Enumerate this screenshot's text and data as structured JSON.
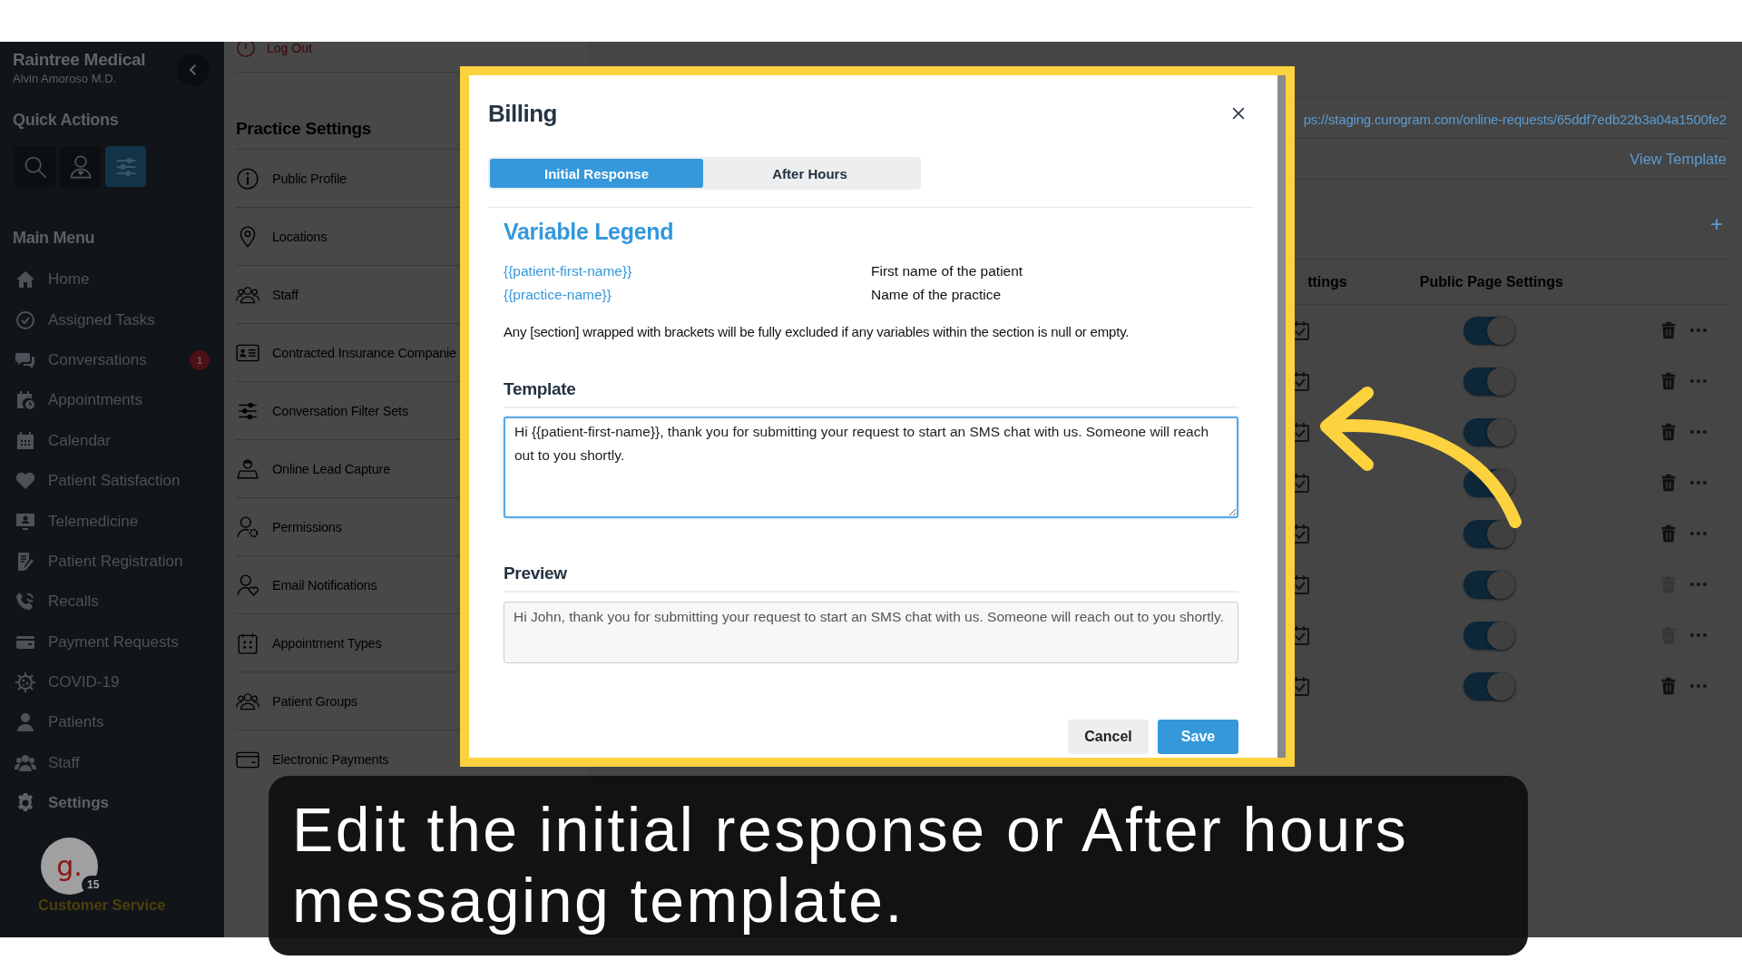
{
  "sidebar": {
    "brand": "Raintree Medical",
    "user": "Alvin Amoroso M.D.",
    "quick_actions_title": "Quick Actions",
    "quick_actions": [
      {
        "selected": false
      },
      {
        "selected": false
      },
      {
        "selected": true
      }
    ],
    "main_menu_title": "Main Menu",
    "menu": [
      {
        "label": "Home",
        "selected": false
      },
      {
        "label": "Assigned Tasks",
        "selected": false
      },
      {
        "label": "Conversations",
        "selected": false,
        "badge": "1"
      },
      {
        "label": "Appointments",
        "selected": false
      },
      {
        "label": "Calendar",
        "selected": false
      },
      {
        "label": "Patient Satisfaction",
        "selected": false
      },
      {
        "label": "Telemedicine",
        "selected": false
      },
      {
        "label": "Patient Registration",
        "selected": false
      },
      {
        "label": "Recalls",
        "selected": false
      },
      {
        "label": "Payment Requests",
        "selected": false
      },
      {
        "label": "COVID-19",
        "selected": false
      },
      {
        "label": "Patients",
        "selected": false
      },
      {
        "label": "Staff",
        "selected": false
      },
      {
        "label": "Settings",
        "selected": true
      }
    ],
    "account": {
      "avatar_text": "g.",
      "badge": "15",
      "name": "Customer Service"
    }
  },
  "practice_settings": {
    "logout": "Log Out",
    "title": "Practice Settings",
    "items": [
      {
        "label": "Public Profile"
      },
      {
        "label": "Locations"
      },
      {
        "label": "Staff"
      },
      {
        "label": "Contracted Insurance Companie"
      },
      {
        "label": "Conversation Filter Sets"
      },
      {
        "label": "Online Lead Capture"
      },
      {
        "label": "Permissions"
      },
      {
        "label": "Email Notifications"
      },
      {
        "label": "Appointment Types"
      },
      {
        "label": "Patient Groups"
      },
      {
        "label": "Electronic Payments"
      }
    ]
  },
  "main": {
    "link": "ps://staging.curogram.com/online-requests/65ddf7edb22b3a04a1500fe2",
    "view_template": "View Template",
    "add": "+",
    "columns": [
      "ttings",
      "Public Page Settings"
    ],
    "rows": [
      {
        "public_page": true,
        "delete_disabled": false
      },
      {
        "public_page": true,
        "delete_disabled": false
      },
      {
        "public_page": true,
        "delete_disabled": false
      },
      {
        "public_page": true,
        "delete_disabled": false
      },
      {
        "public_page": true,
        "delete_disabled": false
      },
      {
        "public_page": true,
        "delete_disabled": true
      },
      {
        "public_page": true,
        "delete_disabled": true
      },
      {
        "public_page": true,
        "delete_disabled": false
      }
    ]
  },
  "modal": {
    "title": "Billing",
    "tabs": [
      {
        "label": "Initial Response",
        "selected": true
      },
      {
        "label": "After Hours",
        "selected": false
      }
    ],
    "legend_title": "Variable Legend",
    "variables": [
      {
        "name": "{{patient-first-name}}",
        "description": "First name of the patient"
      },
      {
        "name": "{{practice-name}}",
        "description": "Name of the practice"
      }
    ],
    "note": "Any [section] wrapped with brackets will be fully excluded if any variables within the section is null or empty.",
    "template_label": "Template",
    "template_value": "Hi {{patient-first-name}}, thank you for submitting your request to start an SMS chat with us. Someone will reach out to you shortly.",
    "preview_label": "Preview",
    "preview_text": "Hi John, thank you for submitting your request to start an SMS chat with us. Someone will reach out to you shortly.",
    "buttons": [
      {
        "label": "Cancel",
        "kind": "secondary"
      },
      {
        "label": "Save",
        "kind": "primary"
      }
    ]
  },
  "caption": "Edit the initial response or After hours messaging template."
}
